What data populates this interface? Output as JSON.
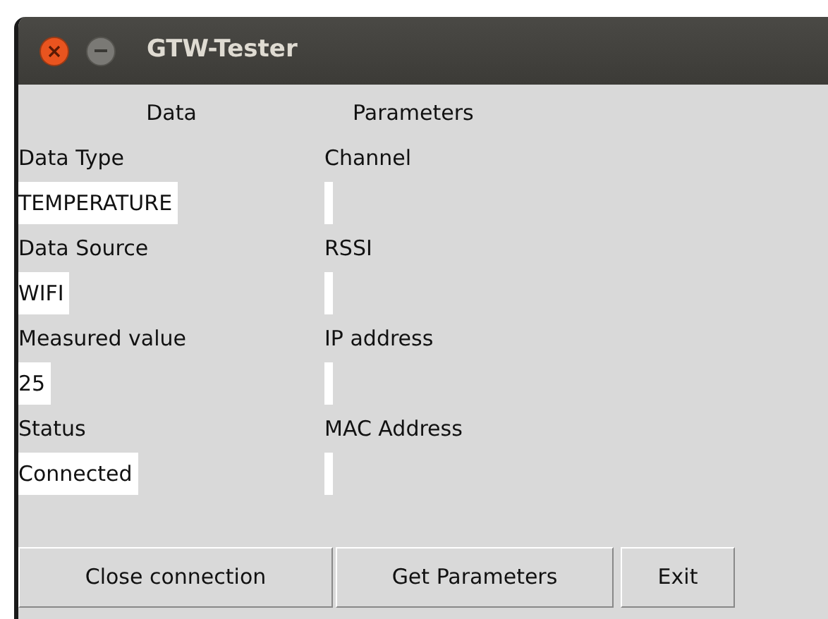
{
  "window": {
    "title": "GTW-Tester"
  },
  "columns": [
    "Data",
    "Parameters"
  ],
  "data_fields": [
    {
      "label": "Data Type",
      "value": "TEMPERATURE"
    },
    {
      "label": "Data Source",
      "value": "WIFI"
    },
    {
      "label": "Measured value",
      "value": "25"
    },
    {
      "label": "Status",
      "value": "Connected"
    }
  ],
  "parameter_fields": [
    {
      "label": "Channel"
    },
    {
      "label": "RSSI"
    },
    {
      "label": "IP address"
    },
    {
      "label": "MAC Address"
    }
  ],
  "buttons": [
    "Close connection",
    "Get Parameters",
    "Exit"
  ]
}
